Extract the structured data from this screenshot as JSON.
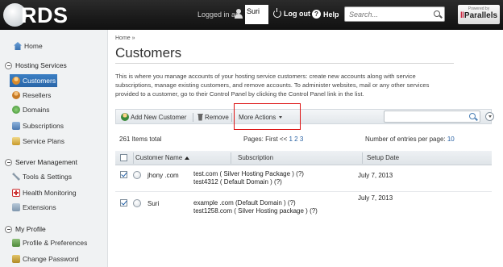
{
  "header": {
    "logo_text": "RDS",
    "logged_in_label": "Logged in as",
    "user_name": "Suri",
    "logout_label": "Log out",
    "help_label": "Help",
    "search_placeholder": "Search...",
    "powered_by": "Powered by",
    "brand": "Parallels"
  },
  "sidebar": {
    "home": "Home",
    "groups": [
      {
        "label": "Hosting Services",
        "items": [
          "Customers",
          "Resellers",
          "Domains",
          "Subscriptions",
          "Service Plans"
        ]
      },
      {
        "label": "Server Management",
        "items": [
          "Tools & Settings",
          "Health Monitoring",
          "Extensions"
        ]
      },
      {
        "label": "My Profile",
        "items": [
          "Profile & Preferences",
          "Change Password"
        ]
      }
    ],
    "active_item": "Customers"
  },
  "main": {
    "breadcrumb": "Home »",
    "title": "Customers",
    "description": "This is where you manage accounts of your hosting service customers: create new accounts along with service subscriptions, manage existing customers, and remove accounts. To administer websites, mail or any other services provided to a customer, go to their Control Panel by clicking the Control Panel link in the list.",
    "toolbar": {
      "add_label": "Add New Customer",
      "remove_label": "Remove",
      "more_actions_label": "More Actions"
    },
    "stats": {
      "total": "261 Items total",
      "pages_label": "Pages: First <<",
      "pages_links": "1 2 3",
      "per_page_label": "Number of entries per page:",
      "per_page_value": "10"
    },
    "table": {
      "columns": [
        "Customer Name",
        "Subscription",
        "Setup Date"
      ],
      "rows": [
        {
          "checked": true,
          "name": "jhony .com",
          "subscription_line1": "test.com ( Silver Hosting Package ) (?)",
          "subscription_line2": "test4312 ( Default Domain ) (?)",
          "setup_date": "July 7, 2013"
        },
        {
          "checked": true,
          "name": "Suri",
          "subscription_line1": "example .com (Default Domain ) (?)",
          "subscription_line2": "test1258.com ( Silver Hosting package ) (?)",
          "setup_date": "July 7, 2013"
        }
      ]
    }
  },
  "colors": {
    "topbar": "#1a1a1a",
    "active_nav": "#2f6fb3",
    "link": "#2a62a3",
    "highlight_box": "#dd1111",
    "sidebar_bg": "#f0f2f3"
  }
}
